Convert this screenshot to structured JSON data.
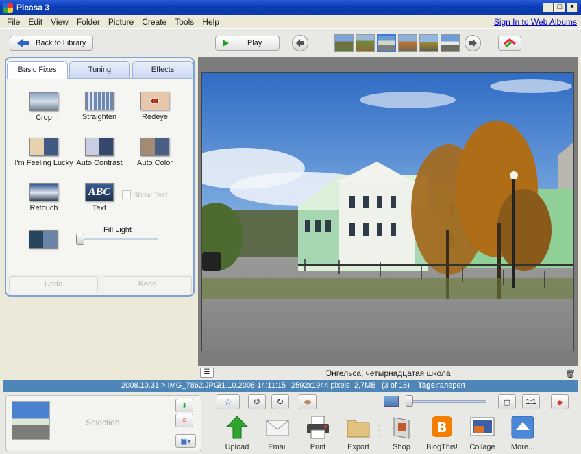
{
  "window": {
    "title": "Picasa 3"
  },
  "menu": {
    "items": [
      "File",
      "Edit",
      "View",
      "Folder",
      "Picture",
      "Create",
      "Tools",
      "Help"
    ],
    "signin": "Sign In to Web Albums"
  },
  "toolbar": {
    "back_label": "Back to Library",
    "play_label": "Play"
  },
  "tabs": [
    "Basic Fixes",
    "Tuning",
    "Effects"
  ],
  "tools": {
    "crop": "Crop",
    "straighten": "Straighten",
    "redeye": "Redeye",
    "lucky": "I'm Feeling Lucky",
    "autocontrast": "Auto Contrast",
    "autocolor": "Auto Color",
    "retouch": "Retouch",
    "text": "Text",
    "showtext": "Show Text",
    "text_icon": "ABC"
  },
  "filllight": {
    "label": "Fill Light",
    "value": 0.0
  },
  "history": {
    "undo": "Undo",
    "redo": "Redo"
  },
  "caption": "Энгельса, четырнадцатая школа",
  "info": {
    "path": "2008.10.31 > IMG_7862.JPG",
    "datetime": "31.10.2008 14:11:15",
    "dims": "2592x1944 pixels",
    "size": "2,7MB",
    "position": "(3 of 16)",
    "tags_label": "Tags:",
    "tags": "галерея"
  },
  "tray": {
    "label": "Selection"
  },
  "zoom": {
    "onetoone": "1:1",
    "value": 0.0
  },
  "actions": [
    "Upload",
    "Email",
    "Print",
    "Export",
    "Shop",
    "BlogThis!",
    "Collage",
    "More..."
  ],
  "colors": {
    "accent": "#4f86b8",
    "tab_border": "#7ea1d9"
  }
}
